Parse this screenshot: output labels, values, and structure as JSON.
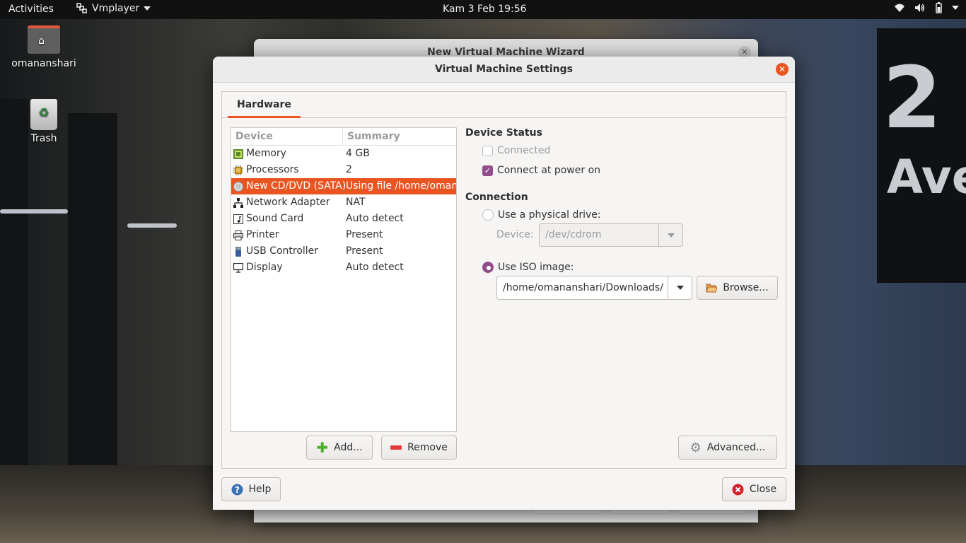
{
  "topbar": {
    "activities": "Activities",
    "app_name": "Vmplayer",
    "clock": "Kam  3 Feb  19:56"
  },
  "desktop": {
    "home_label": "omananshari",
    "trash_label": "Trash"
  },
  "wallpaper_text": {
    "num": "2",
    "word": "Ave"
  },
  "back_window": {
    "title": "New Virtual Machine Wizard"
  },
  "dialog": {
    "title": "Virtual Machine Settings",
    "tab": "Hardware",
    "list_headers": {
      "device": "Device",
      "summary": "Summary"
    },
    "devices": [
      {
        "name": "Memory",
        "summary": "4 GB",
        "icon": "memory-icon"
      },
      {
        "name": "Processors",
        "summary": "2",
        "icon": "processor-icon"
      },
      {
        "name": "New CD/DVD (SATA)",
        "summary": "Using file /home/omananshari/Downloads/",
        "icon": "cd-dvd-icon",
        "selected": true
      },
      {
        "name": "Network Adapter",
        "summary": "NAT",
        "icon": "network-icon"
      },
      {
        "name": "Sound Card",
        "summary": "Auto detect",
        "icon": "sound-icon"
      },
      {
        "name": "Printer",
        "summary": "Present",
        "icon": "printer-icon"
      },
      {
        "name": "USB Controller",
        "summary": "Present",
        "icon": "usb-icon"
      },
      {
        "name": "Display",
        "summary": "Auto detect",
        "icon": "display-icon"
      }
    ],
    "add_button": "Add...",
    "remove_button": "Remove",
    "device_status": {
      "title": "Device Status",
      "connected": "Connected",
      "connect_at_power_on": "Connect at power on"
    },
    "connection": {
      "title": "Connection",
      "physical_drive": "Use a physical drive:",
      "device_label": "Device:",
      "device_value": "/dev/cdrom",
      "use_iso": "Use ISO image:",
      "iso_path": "/home/omananshari/Downloads/",
      "browse": "Browse..."
    },
    "advanced_button": "Advanced...",
    "help_button": "Help",
    "close_button": "Close"
  },
  "colors": {
    "accent": "#e95420",
    "check": "#924d8b"
  }
}
